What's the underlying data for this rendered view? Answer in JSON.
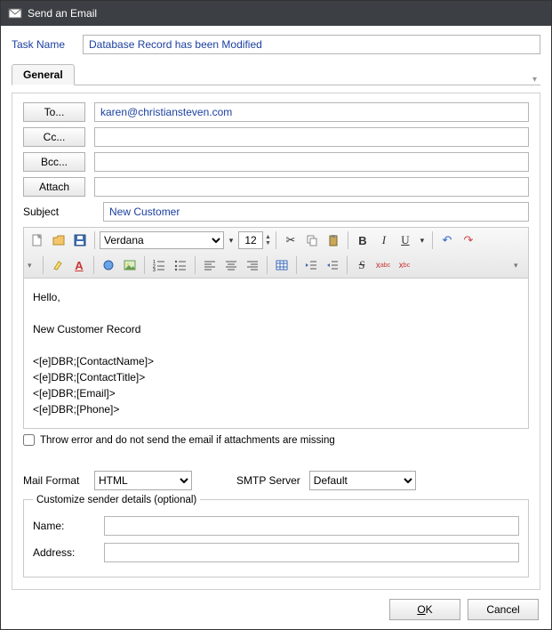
{
  "window": {
    "title": "Send an Email"
  },
  "task": {
    "label": "Task Name",
    "value": "Database Record has been Modified"
  },
  "tabs": {
    "general": "General"
  },
  "fields": {
    "to": {
      "label": "To...",
      "value": "karen@christiansteven.com"
    },
    "cc": {
      "label": "Cc...",
      "value": ""
    },
    "bcc": {
      "label": "Bcc...",
      "value": ""
    },
    "attach": {
      "label": "Attach",
      "value": ""
    },
    "subject": {
      "label": "Subject",
      "value": "New Customer"
    }
  },
  "editor": {
    "font": "Verdana",
    "size": "12",
    "body": "Hello,\n\nNew Customer Record\n\n<[e]DBR;[ContactName]>\n<[e]DBR;[ContactTitle]>\n<[e]DBR;[Email]>\n<[e]DBR;[Phone]>"
  },
  "throw_error_label": "Throw error and do not send the email if attachments are missing",
  "mailformat": {
    "label": "Mail Format",
    "value": "HTML"
  },
  "smtp": {
    "label": "SMTP Server",
    "value": "Default"
  },
  "sender": {
    "legend": "Customize sender details (optional)",
    "name_label": "Name:",
    "name_value": "",
    "addr_label": "Address:",
    "addr_value": ""
  },
  "buttons": {
    "ok": "OK",
    "cancel": "Cancel"
  }
}
